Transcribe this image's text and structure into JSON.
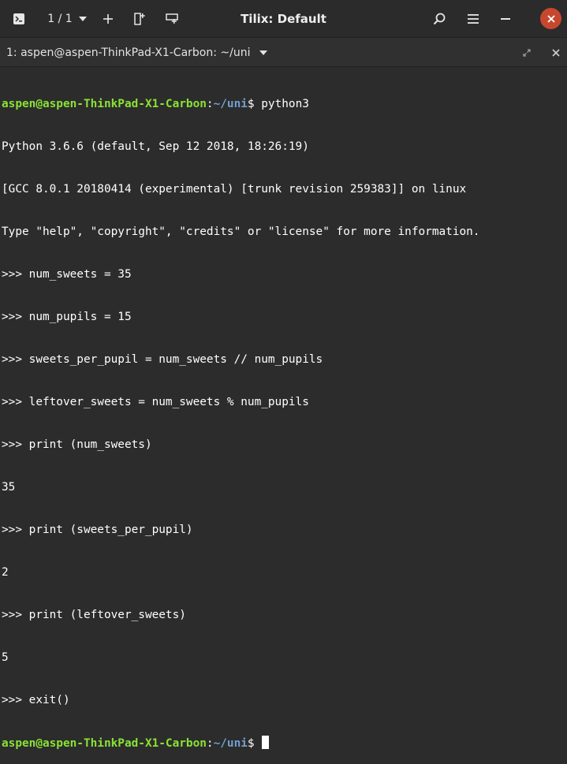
{
  "titlebar": {
    "title": "Tilix: Default",
    "session_counter": "1 / 1"
  },
  "tab": {
    "title": "1: aspen@aspen-ThinkPad-X1-Carbon: ~/uni"
  },
  "terminal": {
    "lines": [
      {
        "user": "aspen@aspen-ThinkPad-X1-Carbon",
        "colon": ":",
        "path": "~/uni",
        "rest": "$ python3"
      },
      {
        "text": "Python 3.6.6 (default, Sep 12 2018, 18:26:19)"
      },
      {
        "text": "[GCC 8.0.1 20180414 (experimental) [trunk revision 259383]] on linux"
      },
      {
        "text": "Type \"help\", \"copyright\", \"credits\" or \"license\" for more information."
      },
      {
        "text": ">>> num_sweets = 35"
      },
      {
        "text": ">>> num_pupils = 15"
      },
      {
        "text": ">>> sweets_per_pupil = num_sweets // num_pupils"
      },
      {
        "text": ">>> leftover_sweets = num_sweets % num_pupils"
      },
      {
        "text": ">>> print (num_sweets)"
      },
      {
        "text": "35"
      },
      {
        "text": ">>> print (sweets_per_pupil)"
      },
      {
        "text": "2"
      },
      {
        "text": ">>> print (leftover_sweets)"
      },
      {
        "text": "5"
      },
      {
        "text": ">>> exit()"
      },
      {
        "user": "aspen@aspen-ThinkPad-X1-Carbon",
        "colon": ":",
        "path": "~/uni",
        "rest": "$ "
      }
    ]
  },
  "colors": {
    "prompt_user": "#8ae234",
    "prompt_path": "#729fcf",
    "close_button": "#c7472e"
  }
}
